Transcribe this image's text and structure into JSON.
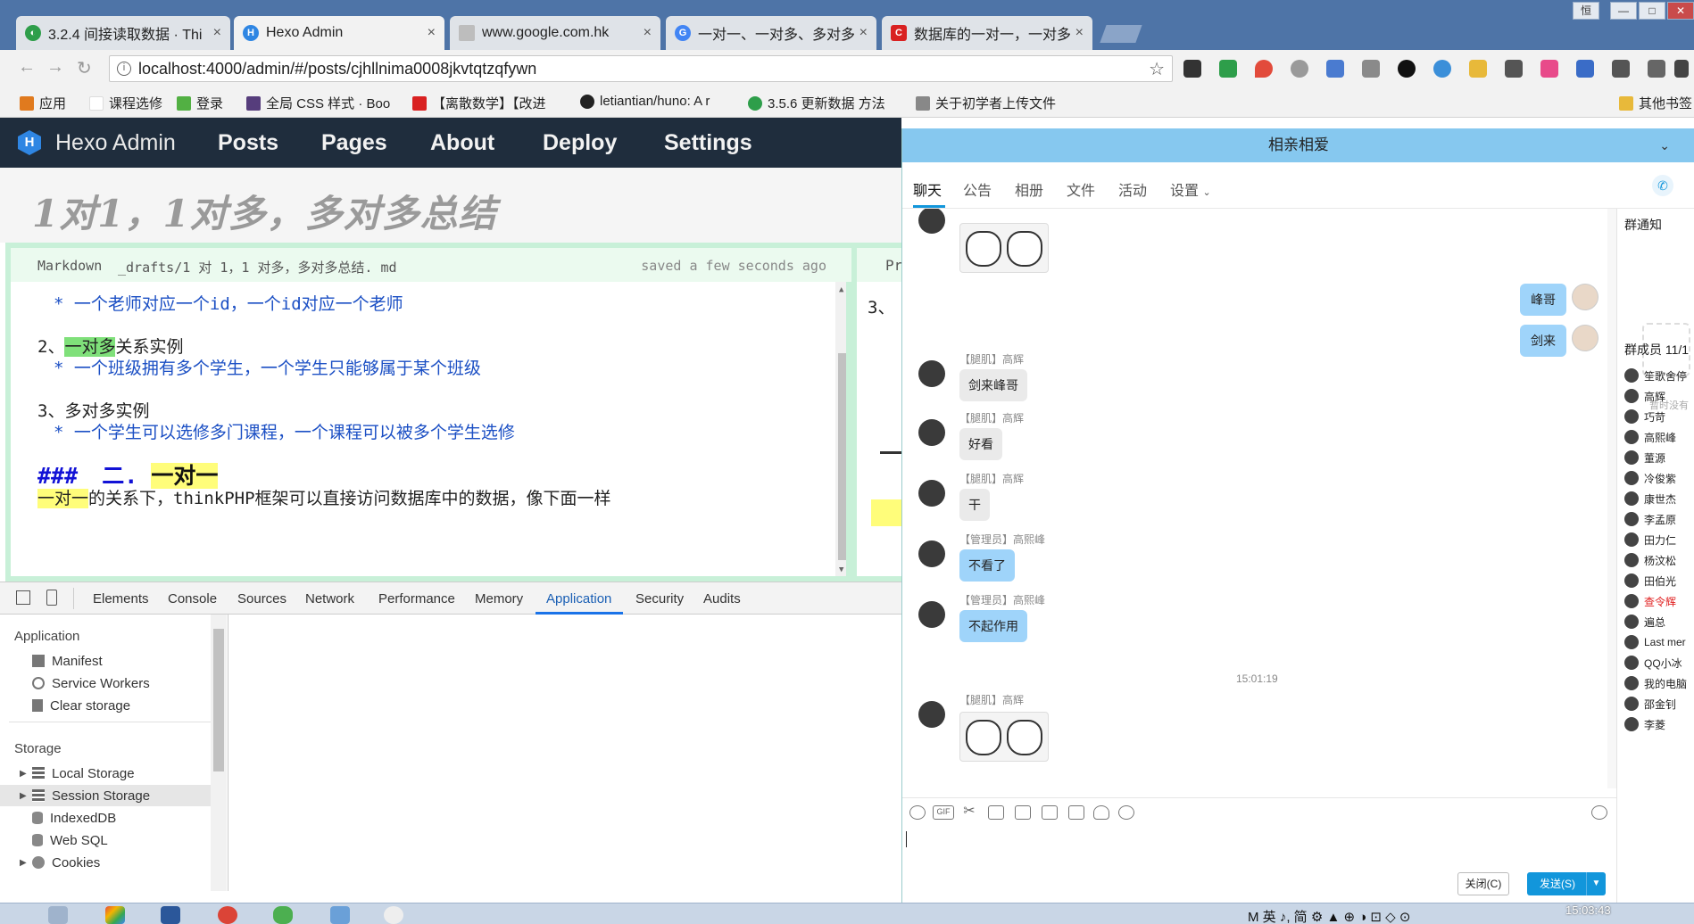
{
  "browser": {
    "tabs": [
      {
        "title": "3.2.4 间接读取数据 · Thi",
        "color": "#2e9e4a"
      },
      {
        "title": "Hexo Admin",
        "color": "#2f86e3"
      },
      {
        "title": "www.google.com.hk",
        "color": "#9a9a9a"
      },
      {
        "title": "一对一、一对多、多对多",
        "color": "#4285f4"
      },
      {
        "title": "数据库的一对一，一对多",
        "color": "#d92121"
      }
    ],
    "tab_close": "×",
    "window_controls": [
      "恒",
      "—",
      "□",
      "✕"
    ],
    "url": "localhost:4000/admin/#/posts/cjhllnima0008jkvtqtzqfywn",
    "bookmarks": [
      {
        "label": "应用",
        "color": "#e07a1e"
      },
      {
        "label": "课程选修",
        "color": "#ffffff"
      },
      {
        "label": "登录",
        "color": "#52b043"
      },
      {
        "label": "全局 CSS 样式 · Boo",
        "color": "#563d7c"
      },
      {
        "label": "【离散数学】【改进",
        "color": "#d92121"
      },
      {
        "label": "letiantian/huno: A r",
        "color": "#222222"
      },
      {
        "label": "3.5.6 更新数据 方法",
        "color": "#2e9e4a"
      },
      {
        "label": "关于初学者上传文件",
        "color": "#888888"
      },
      {
        "label": "其他书签",
        "color": "#e8b93a"
      }
    ]
  },
  "hexo": {
    "brand": "Hexo Admin",
    "logo_letter": "H",
    "nav": [
      "Posts",
      "Pages",
      "About",
      "Deploy",
      "Settings"
    ],
    "post_title": "1对1，1对多，多对多总结",
    "editor": {
      "mode": "Markdown",
      "filename": "_drafts/1 对 1，1 对多，多对多总结. md",
      "status": "saved a few seconds ago",
      "preview_label": "Pre",
      "lines": {
        "l1": "* 一个老师对应一个id，一个id对应一个老师",
        "l2_prefix": "2、",
        "l2_highlight": "一对多",
        "l2_suffix": "关系实例",
        "l3": "* 一个班级拥有多个学生，一个学生只能够属于某个班级",
        "l4": "3、多对多实例",
        "l5": "* 一个学生可以选修多门课程，一个课程可以被多个学生选修",
        "l6_hash": "###",
        "l6_num": "二.",
        "l6_highlight": "一对一",
        "l7_highlight": "一对一",
        "l7_rest": "的关系下，thinkPHP框架可以直接访问数据库中的数据，像下面一样"
      },
      "preview_line": "3、"
    }
  },
  "devtools": {
    "tabs": [
      "Elements",
      "Console",
      "Sources",
      "Network",
      "Performance",
      "Memory",
      "Application",
      "Security",
      "Audits"
    ],
    "active_tab": "Application",
    "sections": {
      "application": "Application",
      "storage": "Storage"
    },
    "app_items": [
      "Manifest",
      "Service Workers",
      "Clear storage"
    ],
    "storage_items": [
      "Local Storage",
      "Session Storage",
      "IndexedDB",
      "Web SQL",
      "Cookies"
    ],
    "selected_item": "Session Storage"
  },
  "qq": {
    "title": "相亲相爱",
    "tabs": [
      "聊天",
      "公告",
      "相册",
      "文件",
      "活动",
      "设置"
    ],
    "messages": [
      {
        "sender": "【腿肌】高辉",
        "text": "剑来峰哥"
      },
      {
        "sender": "【腿肌】高辉",
        "text": "好看"
      },
      {
        "sender": "【腿肌】高辉",
        "text": "干"
      },
      {
        "sender": "【管理员】高熙峰",
        "text": "不看了"
      },
      {
        "sender": "【管理员】高熙峰",
        "text": "不起作用"
      },
      {
        "sender": "【腿肌】高辉",
        "text": ""
      }
    ],
    "my_messages": [
      "峰哥",
      "剑来"
    ],
    "time": "15:01:19",
    "right_panel": {
      "notice_title": "群通知",
      "notice_empty": "暂时没有",
      "members_title": "群成员 11/1",
      "members": [
        "笙歌舍停",
        "高辉",
        "巧苛",
        "高熙峰",
        "董源",
        "冷俊紫",
        "康世杰",
        "李孟原",
        "田力仁",
        "杨汶松",
        "田伯光",
        "查令辉",
        "遍总",
        "Last mer",
        "QQ小冰",
        "我的电脑",
        "邵金钊",
        "李菱"
      ],
      "highlight_member": "查令辉",
      "highlight_color": "#e02020"
    },
    "buttons": {
      "close": "关闭(C)",
      "send": "发送(S)"
    },
    "tool_labels": [
      "GIF"
    ]
  },
  "taskbar": {
    "tray": "M 英 ♪, 简 ⚙ ▲ ⊕ ◑ ⊡ ◇ ⊙",
    "clock": "15:03:43"
  }
}
